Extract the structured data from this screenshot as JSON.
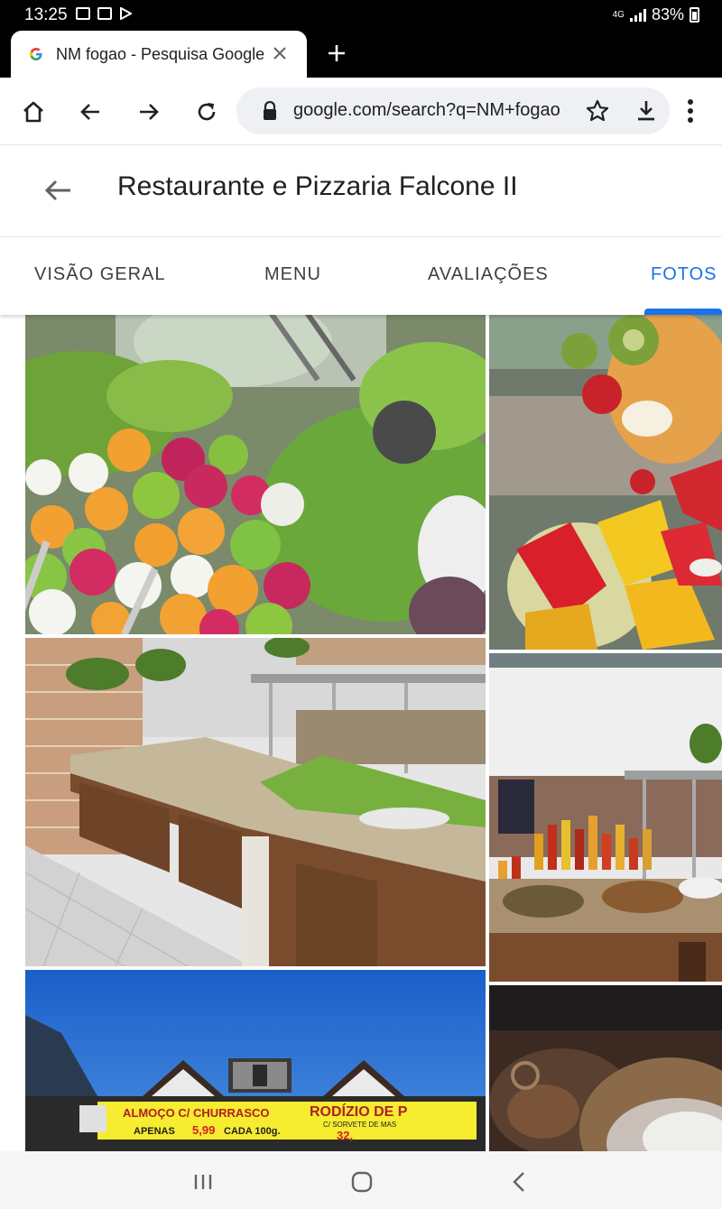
{
  "status_bar": {
    "time": "13:25",
    "network": "4G",
    "battery": "83%"
  },
  "browser_tab": {
    "title": "NM fogao - Pesquisa Google",
    "close_icon": "close-icon",
    "new_tab_icon": "plus-icon"
  },
  "toolbar": {
    "url": "google.com/search?q=NM+fogao",
    "icons": [
      "home-icon",
      "back-icon",
      "forward-icon",
      "reload-icon",
      "lock-icon",
      "star-icon",
      "download-icon",
      "more-icon"
    ]
  },
  "header": {
    "title": "Restaurante e Pizzaria Falcone II"
  },
  "tabs": [
    {
      "label": "VISÃO GERAL",
      "active": false
    },
    {
      "label": "MENU",
      "active": false
    },
    {
      "label": "AVALIAÇÕES",
      "active": false
    },
    {
      "label": "FOTOS",
      "active": true
    }
  ],
  "photos": {
    "sign_text_1": "ALMOÇO C/ CHURRASCO",
    "sign_text_2": "APENAS",
    "sign_price_1": "5,99",
    "sign_text_3": "CADA 100g.",
    "sign_text_4": "RODÍZIO DE P",
    "sign_text_5": "C/ SORVETE DE MAS",
    "sign_price_2": "32,"
  },
  "colors": {
    "accent": "#1a73e8",
    "status_bar": "#000000",
    "tab_text": "#3c4043"
  }
}
